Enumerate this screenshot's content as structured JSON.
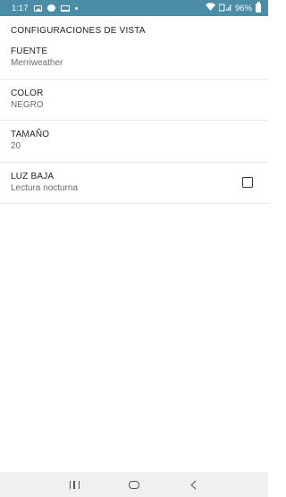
{
  "status_bar": {
    "time": "1:17",
    "battery_percent": "96%",
    "icons": [
      "image-icon",
      "chat-icon",
      "laptop-icon",
      "dot-icon",
      "wifi-icon",
      "volte-signal-icon",
      "battery-icon"
    ],
    "background_color": "#4b8ca6"
  },
  "page": {
    "title": "CONFIGURACIONES DE VISTA"
  },
  "settings": [
    {
      "title": "FUENTE",
      "value": "Merriweather"
    },
    {
      "title": "COLOR",
      "value": "NEGRO"
    },
    {
      "title": "TAMAÑO",
      "value": "20"
    },
    {
      "title": "LUZ BAJA",
      "value": "Lectura nocturna",
      "checkbox_checked": false
    }
  ],
  "nav_bar": {
    "buttons": [
      "recent-apps-icon",
      "home-icon",
      "back-icon"
    ]
  }
}
